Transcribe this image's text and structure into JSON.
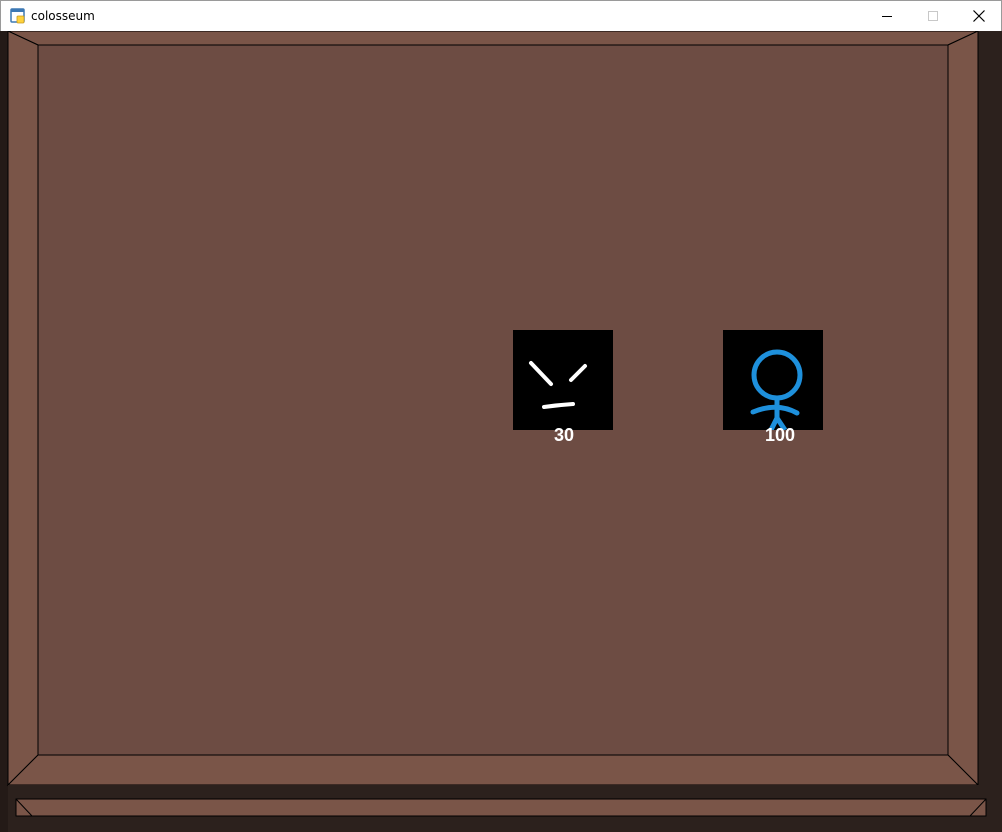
{
  "window": {
    "title": "colosseum",
    "icon": "python-app-icon",
    "controls": [
      "minimize",
      "maximize",
      "close"
    ]
  },
  "colors": {
    "arena_floor": "#6d4c43",
    "arena_wall": "#7a5548",
    "outer_background": "#2c211d",
    "sprite_background": "#000000",
    "player_color": "#1e90dc",
    "enemy_color": "#ffffff",
    "hp_text": "#ffffff"
  },
  "enemy": {
    "icon": "angry-face-icon",
    "hp": "30"
  },
  "player": {
    "icon": "stick-figure-icon",
    "hp": "100"
  }
}
